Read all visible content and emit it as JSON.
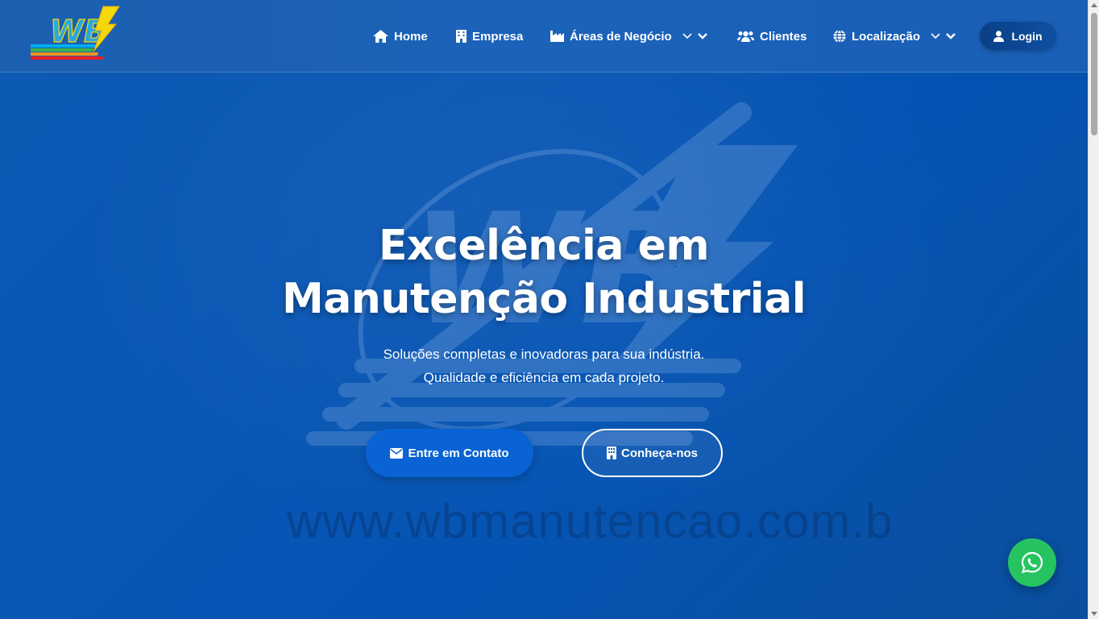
{
  "brand": {
    "logo_text": "WB"
  },
  "nav": {
    "items": [
      {
        "label": "Home",
        "icon": "home-icon"
      },
      {
        "label": "Empresa",
        "icon": "building-icon"
      },
      {
        "label": "Áreas de Negócio",
        "icon": "industry-icon",
        "dropdown": true
      },
      {
        "label": "Clientes",
        "icon": "users-icon"
      },
      {
        "label": "Localização",
        "icon": "globe-icon",
        "dropdown": true
      }
    ],
    "login_label": "Login"
  },
  "hero": {
    "headline_line1": "Excelência em",
    "headline_line2": "Manutenção Industrial",
    "subtitle_line1": "Soluções completas e inovadoras para sua indústria.",
    "subtitle_line2": "Qualidade e eficiência em cada projeto.",
    "primary_button": "Entre em Contato",
    "secondary_button": "Conheça-nos",
    "watermark_url": "www.wbmanutencao.com.b"
  },
  "colors": {
    "nav_background": "#1b62b9",
    "hero_background": "#0a57b4",
    "primary_button": "#0a63d4",
    "login_button": "#0a3f86",
    "whatsapp": "#25c461",
    "text": "#ffffff"
  }
}
